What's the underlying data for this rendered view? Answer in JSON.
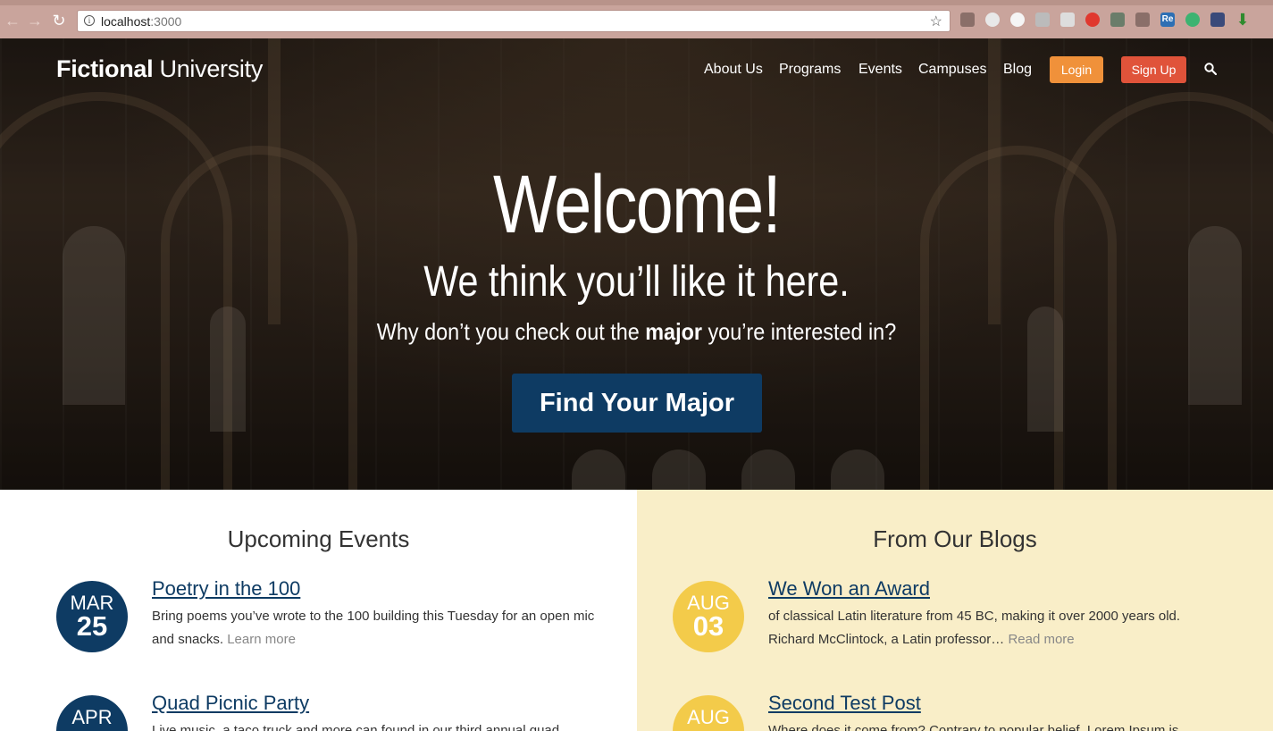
{
  "browser": {
    "url_host": "localhost",
    "url_port": ":3000",
    "back_icon": "arrow-left",
    "forward_icon": "arrow-right",
    "reload_icon": "reload",
    "bookmark_icon": "star"
  },
  "header": {
    "logo_bold": "Fictional",
    "logo_light": "University",
    "nav": [
      "About Us",
      "Programs",
      "Events",
      "Campuses",
      "Blog"
    ],
    "login": "Login",
    "signup": "Sign Up"
  },
  "hero": {
    "title": "Welcome!",
    "subtitle": "We think you’ll like it here.",
    "tagline_pre": "Why don’t you check out the ",
    "tagline_bold": "major",
    "tagline_post": " you’re interested in?",
    "cta": "Find Your Major"
  },
  "events": {
    "heading": "Upcoming Events",
    "items": [
      {
        "month": "MAR",
        "day": "25",
        "title": "Poetry in the 100",
        "desc": "Bring poems you’ve wrote to the 100 building this Tuesday for an open mic and snacks.",
        "more": "Learn more"
      },
      {
        "month": "APR",
        "day": "",
        "title": "Quad Picnic Party",
        "desc": "Live music, a taco truck and more can found in our third annual quad",
        "more": ""
      }
    ]
  },
  "blogs": {
    "heading": "From Our Blogs",
    "items": [
      {
        "month": "AUG",
        "day": "03",
        "title": "We Won an Award",
        "desc": "of classical Latin literature from 45 BC, making it over 2000 years old. Richard McClintock, a Latin professor…",
        "more": "Read more"
      },
      {
        "month": "AUG",
        "day": "",
        "title": "Second Test Post",
        "desc": "Where does it come from? Contrary to popular belief, Lorem Ipsum is",
        "more": ""
      }
    ]
  },
  "colors": {
    "navy": "#0e3b63",
    "orange": "#f0913a",
    "red": "#e0533a",
    "gold": "#f3cb4a",
    "beige": "#f9eec8"
  }
}
